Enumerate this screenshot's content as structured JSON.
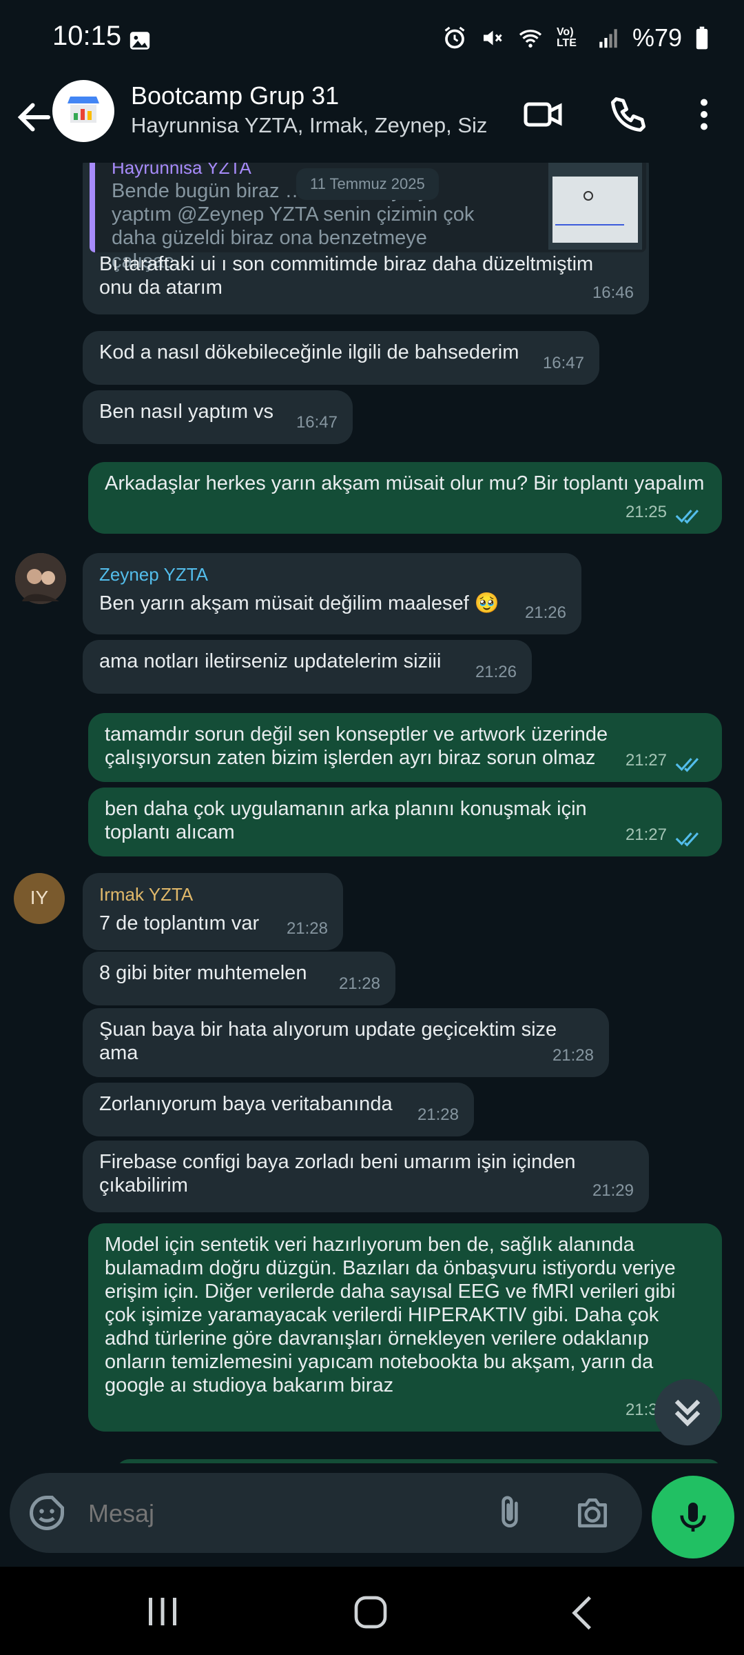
{
  "status_bar": {
    "time": "10:15",
    "battery": "%79",
    "network": "Vo) LTE"
  },
  "header": {
    "title": "Bootcamp Grup 31",
    "subtitle": "Hayrunnisa YZTA, Irmak, Zeynep, Siz"
  },
  "date_separator": "11 Temmuz 2025",
  "quoted": {
    "sender": "Hayrunnisa YZTA",
    "text": "Bende bugün biraz … di ana sayfayı yaptım @Zeynep YZTA senin çizimin çok daha güzeldi biraz ona benzetmeye çalışac..."
  },
  "messages": [
    {
      "text": "Bı taraftaki ui ı son commitimde biraz daha düzeltmiştim onu da atarım",
      "time": "16:46"
    },
    {
      "text": "Kod a nasıl dökebileceğinle ilgili de bahsederim",
      "time": "16:47"
    },
    {
      "text": "Ben nasıl yaptım vs",
      "time": "16:47"
    },
    {
      "text": "Arkadaşlar herkes yarın akşam müsait olur mu? Bir toplantı yapalım",
      "time": "21:25"
    },
    {
      "sender": "Zeynep YZTA",
      "text": "Ben yarın akşam müsait değilim maalesef 🥹",
      "time": "21:26"
    },
    {
      "text": "ama notları iletirseniz updatelerim siziii",
      "time": "21:26"
    },
    {
      "text": "tamamdır sorun değil sen konseptler ve artwork üzerinde çalışıyorsun zaten bizim işlerden ayrı biraz sorun olmaz",
      "time": "21:27"
    },
    {
      "text": "ben daha çok uygulamanın arka planını konuşmak için toplantı alıcam",
      "time": "21:27"
    },
    {
      "sender": "Irmak YZTA",
      "text": "7 de toplantım var",
      "time": "21:28"
    },
    {
      "text": "8 gibi biter muhtemelen",
      "time": "21:28"
    },
    {
      "text": "Şuan baya bir hata alıyorum update geçicektim size ama",
      "time": "21:28"
    },
    {
      "text": "Zorlanıyorum baya veritabanında",
      "time": "21:28"
    },
    {
      "text": "Firebase configi baya zorladı beni umarım işin içinden çıkabilirim",
      "time": "21:29"
    },
    {
      "text": "Model için sentetik veri hazırlıyorum ben de, sağlık alanında bulamadım doğru düzgün. Bazıları da önbaşvuru istiyordu veriye erişim için. Diğer verilerde daha sayısal EEG ve fMRI verileri gibi çok işimize yaramayacak verilerdi HIPERAKTIV gibi. Daha çok adhd türlerine göre davranışları örnekleyen verilere odaklanıp onların temizlemesini yapıcam notebookta bu akşam, yarın da google aı studioya bakarım biraz",
      "time": "21:31"
    }
  ],
  "irmak_avatar_initials": "IY",
  "composer": {
    "placeholder": "Mesaj"
  }
}
